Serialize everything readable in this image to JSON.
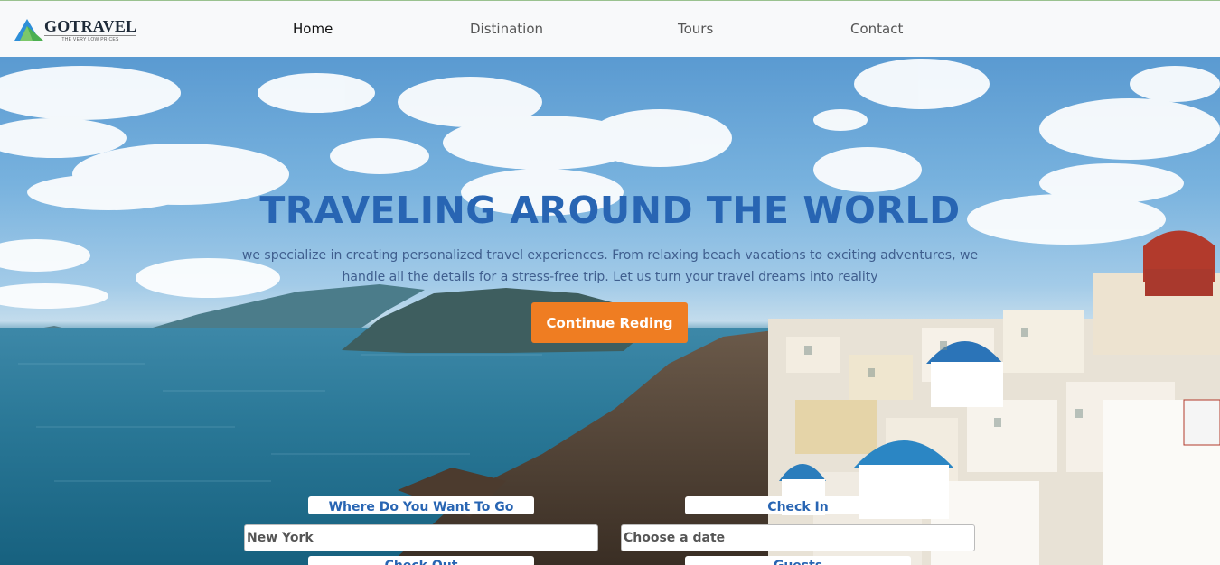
{
  "brand": {
    "name": "GOTRAVEL",
    "tagline": "THE VERY LOW PRICES",
    "colors": {
      "blue": "#2e8fd8",
      "green": "#4cb050"
    }
  },
  "nav": {
    "items": [
      {
        "label": "Home",
        "active": true
      },
      {
        "label": "Distination",
        "active": false
      },
      {
        "label": "Tours",
        "active": false
      },
      {
        "label": "Contact",
        "active": false
      }
    ]
  },
  "hero": {
    "title": "TRAVELING AROUND THE WORLD",
    "description": "we specialize in creating personalized travel experiences. From relaxing beach vacations to exciting adventures, we handle all the details for a stress-free trip. Let us turn your travel dreams into reality",
    "cta_label": "Continue Reding",
    "colors": {
      "title": "#2865b3",
      "cta": "#ef7d22"
    }
  },
  "search": {
    "destination": {
      "label": "Where Do You Want To Go",
      "value": "New York"
    },
    "checkin": {
      "label": "Check In",
      "placeholder": "Choose a date"
    },
    "checkout": {
      "label": "Check Out"
    },
    "guests": {
      "label": "Guests"
    }
  }
}
